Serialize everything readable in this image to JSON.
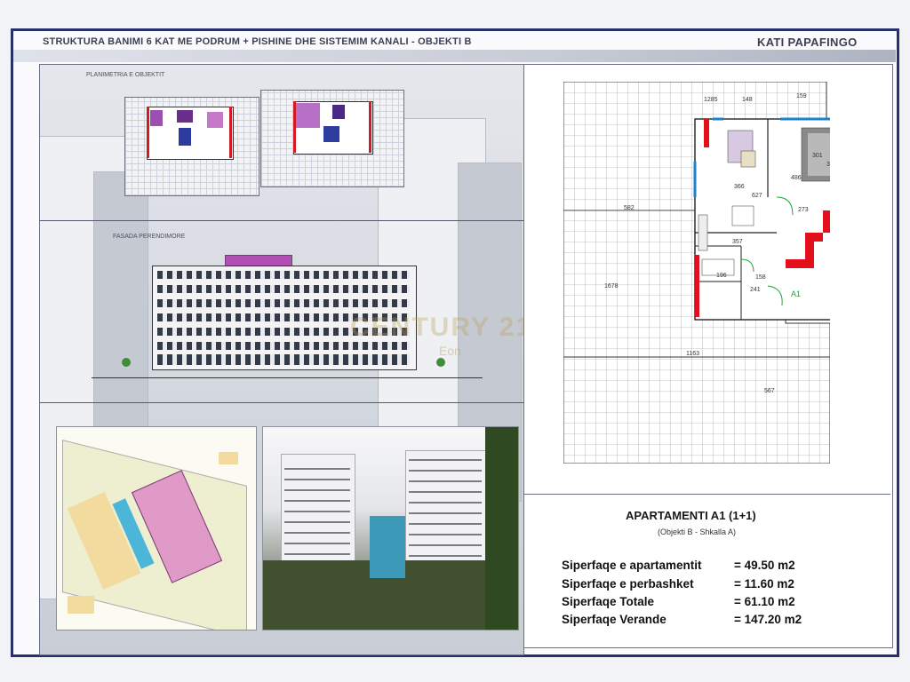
{
  "header": {
    "title": "STRUKTURA BANIMI 6 KAT ME PODRUM + PISHINE DHE SISTEMIM KANALI   -  OBJEKTI B",
    "floor_name": "KATI PAPAFINGO"
  },
  "left_panel": {
    "plan_label": "PLANIMETRIA E OBJEKTIT",
    "facade_label": "FASADA PERENDIMORE"
  },
  "watermark": {
    "brand": "CENTURY 21",
    "office": "Eon"
  },
  "floor_plan": {
    "dims": [
      "1285",
      "148",
      "159",
      "366",
      "627",
      "486",
      "301",
      "330",
      "273",
      "582",
      "357",
      "196",
      "241",
      "158",
      "1678",
      "1163",
      "567"
    ],
    "unit_label": "A1"
  },
  "apartment": {
    "title": "APARTAMENTI A1 (1+1)",
    "subtitle": "(Objekti B - Shkalla A)",
    "areas": [
      {
        "label": "Siperfaqe e apartamentit",
        "value": "= 49.50 m2"
      },
      {
        "label": "Siperfaqe e perbashket",
        "value": "= 11.60 m2"
      },
      {
        "label": "Siperfaqe Totale",
        "value": "= 61.10 m2"
      },
      {
        "label": "Siperfaqe Verande",
        "value": "= 147.20 m2"
      }
    ]
  },
  "colors": {
    "frame": "#27306b",
    "wall_red": "#e3101b",
    "opening_blue": "#1c83c8",
    "door_green": "#1ba53a"
  }
}
